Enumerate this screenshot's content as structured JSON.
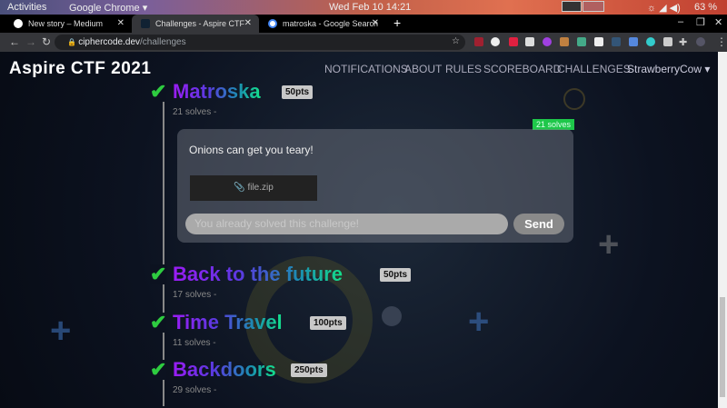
{
  "system": {
    "activities": "Activities",
    "app": "Google Chrome ▾",
    "clock": "Wed Feb 10  14:21",
    "battery": "63 %"
  },
  "tabs": [
    {
      "label": "New story – Medium"
    },
    {
      "label": "Challenges - Aspire CTF"
    },
    {
      "label": "matroska - Google Search"
    }
  ],
  "address": {
    "host": "ciphercode.dev",
    "path": "/challenges"
  },
  "site": {
    "brand": "Aspire CTF 2021",
    "menu": [
      "NOTIFICATIONS",
      "ABOUT",
      "RULES",
      "SCOREBOARD",
      "CHALLENGES",
      "StrawberryCow ▾"
    ]
  },
  "challenges": [
    {
      "title": "Matroska",
      "points": "50pts",
      "solves": "21 solves -"
    },
    {
      "title": "Back to the future",
      "points": "50pts",
      "solves": "17 solves -"
    },
    {
      "title": "Time Travel",
      "points": "100pts",
      "solves": "11 solves -"
    },
    {
      "title": "Backdoors",
      "points": "250pts",
      "solves": "29 solves -"
    }
  ],
  "open_challenge": {
    "badge": "21 solves",
    "description": "Onions can get you teary!",
    "file": "file.zip",
    "placeholder": "You already solved this challenge!",
    "send": "Send"
  }
}
